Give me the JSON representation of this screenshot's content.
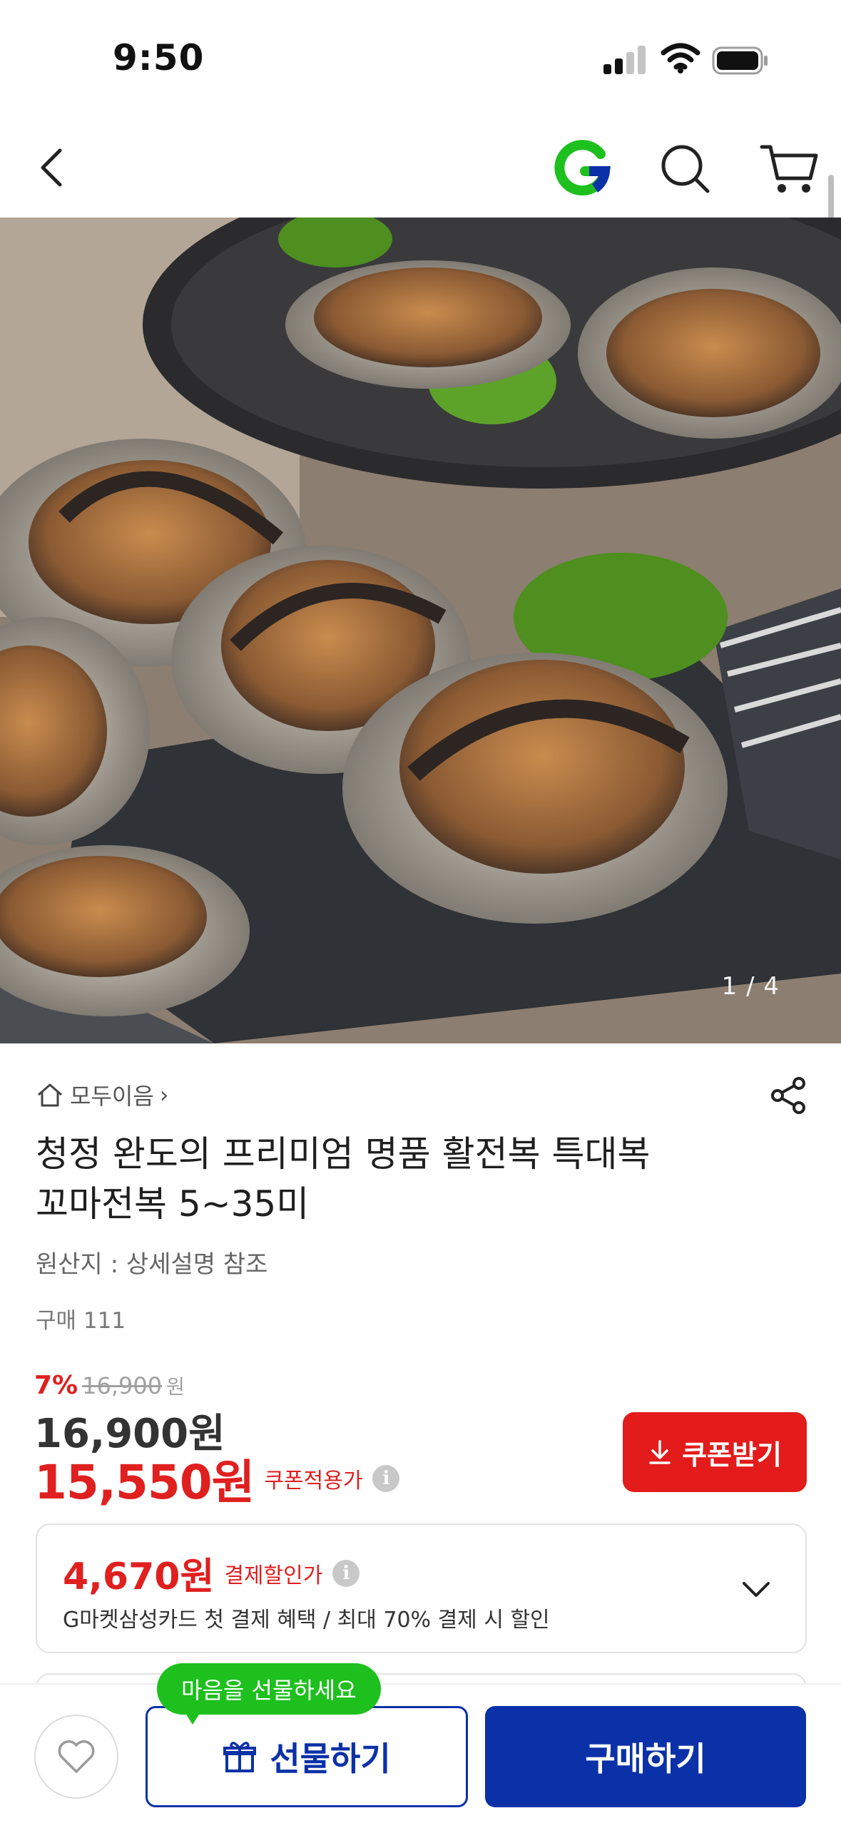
{
  "status_bar": {
    "time": "9:50"
  },
  "header": {
    "back_icon": "chevron-left-icon",
    "logo_icon": "gmarket-g-logo",
    "search_icon": "search-icon",
    "cart_icon": "cart-icon"
  },
  "gallery": {
    "counter": "1 / 4"
  },
  "seller": {
    "name": "모두이음",
    "store_icon": "home-icon",
    "arrow": "›"
  },
  "product": {
    "title_line1": "청정 완도의 프리미엄 명품 활전복 특대복",
    "title_line2": "꼬마전복 5~35미",
    "origin": "원산지 : 상세설명 참조",
    "purchases": "구매 111"
  },
  "price": {
    "discount_rate": "7%",
    "original": "16,900",
    "original_unit": "원",
    "sale": "16,900원",
    "coupon_price": "15,550원",
    "coupon_label": "쿠폰적용가",
    "info_icon": "i"
  },
  "coupon_button": {
    "label": "쿠폰받기",
    "icon": "download-icon"
  },
  "card_offer": {
    "price": "4,670원",
    "label": "결제할인가",
    "info_icon": "i",
    "description": "G마켓삼성카드 첫 결제 혜택 / 최대 70% 결제 시 할인"
  },
  "bottom_bar": {
    "tooltip": "마음을 선물하세요",
    "gift_label": "선물하기",
    "buy_label": "구매하기",
    "like_icon": "heart-icon",
    "gift_icon": "gift-icon"
  },
  "colors": {
    "accent_red": "#e31b1b",
    "brand_blue": "#0b31a8",
    "brand_green": "#1ec01e"
  }
}
